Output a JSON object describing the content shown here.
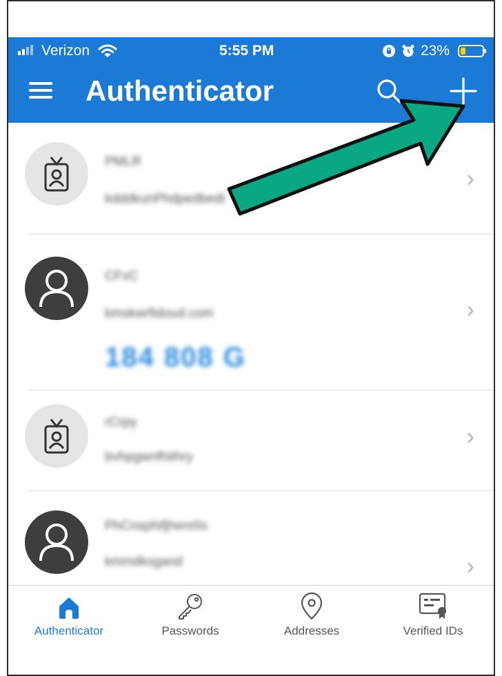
{
  "status_bar": {
    "carrier": "Verizon",
    "time": "5:55 PM",
    "battery": "23%",
    "battery_level": 0.23
  },
  "header": {
    "menu_icon": "hamburger-menu-icon",
    "title": "Authenticator",
    "search_icon": "search-icon",
    "add_icon": "plus-icon"
  },
  "accounts": [
    {
      "icon": "id-badge-icon",
      "name": "PMLR",
      "user": "kdddkunPhdpedbedt",
      "code": ""
    },
    {
      "icon": "person-icon",
      "name": "CFxC",
      "user": "kmskwrfidoud.com",
      "code": "184 808 G"
    },
    {
      "icon": "id-badge-icon",
      "name": "rCrpy",
      "user": "bvhpgwnfhithry",
      "code": ""
    },
    {
      "icon": "person-icon",
      "name": "PhCnsphifjhenrlís",
      "user": "kmmdksgand",
      "code": ""
    }
  ],
  "tabs": [
    {
      "label": "Authenticator",
      "icon": "house-icon",
      "active": true
    },
    {
      "label": "Passwords",
      "icon": "key-icon",
      "active": false
    },
    {
      "label": "Addresses",
      "icon": "location-pin-icon",
      "active": false
    },
    {
      "label": "Verified IDs",
      "icon": "id-card-icon",
      "active": false
    }
  ],
  "colors": {
    "brand_blue": "#1a7ad6",
    "annotation_arrow": "#0aa882"
  }
}
